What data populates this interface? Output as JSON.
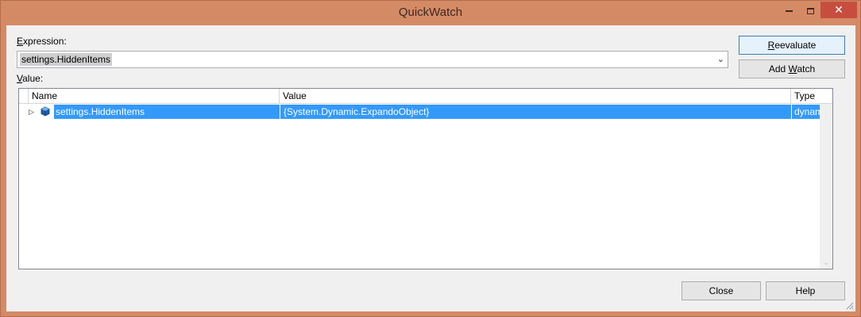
{
  "window": {
    "title": "QuickWatch",
    "minimize_glyph": "",
    "maximize_glyph": "",
    "close_glyph": "✕"
  },
  "expression": {
    "label_accel": "E",
    "label_rest": "xpression:",
    "value": "settings.HiddenItems"
  },
  "value_label": {
    "accel": "V",
    "rest": "alue:"
  },
  "buttons": {
    "reevaluate_accel": "R",
    "reevaluate_rest": "eevaluate",
    "add_watch_pre": "Add ",
    "add_watch_accel": "W",
    "add_watch_rest": "atch",
    "close": "Close",
    "help": "Help"
  },
  "grid": {
    "columns": [
      "Name",
      "Value",
      "Type"
    ],
    "rows": [
      {
        "name": "settings.HiddenItems",
        "value": "{System.Dynamic.ExpandoObject}",
        "type": "dynamic"
      }
    ],
    "selected_row_color": "#3399ff"
  },
  "icons": {
    "expander": "expand-triangle-icon",
    "object": "object-icon"
  }
}
